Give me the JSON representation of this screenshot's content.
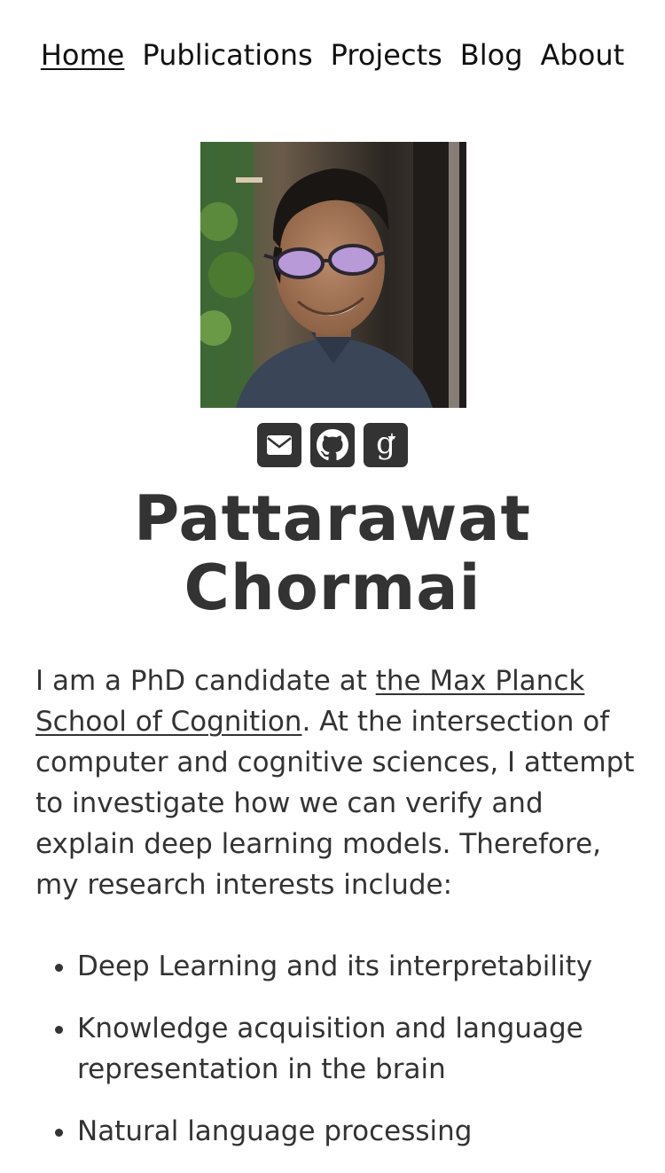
{
  "nav": {
    "items": [
      {
        "label": "Home",
        "active": true
      },
      {
        "label": "Publications",
        "active": false
      },
      {
        "label": "Projects",
        "active": false
      },
      {
        "label": "Blog",
        "active": false
      },
      {
        "label": "About",
        "active": false
      }
    ]
  },
  "profile": {
    "photo_icon": "profile-photo",
    "social": [
      {
        "icon": "envelope-icon"
      },
      {
        "icon": "github-icon"
      },
      {
        "icon": "google-scholar-icon"
      }
    ],
    "name_line1": "Pattarawat",
    "name_line2": "Chormai"
  },
  "bio": {
    "text_before": "I am a PhD candidate at ",
    "link_text": "the Max Planck School of Cognition",
    "text_after": ". At the intersection of computer and cognitive sciences, I attempt to investigate how we can verify and explain deep learning models. Therefore, my research interests include:"
  },
  "interests": [
    "Deep Learning and its interpretability",
    "Knowledge acquisition and language representation in the brain",
    "Natural language processing"
  ],
  "colors": {
    "text": "#333333",
    "icon_bg": "#333333",
    "background": "#ffffff"
  }
}
